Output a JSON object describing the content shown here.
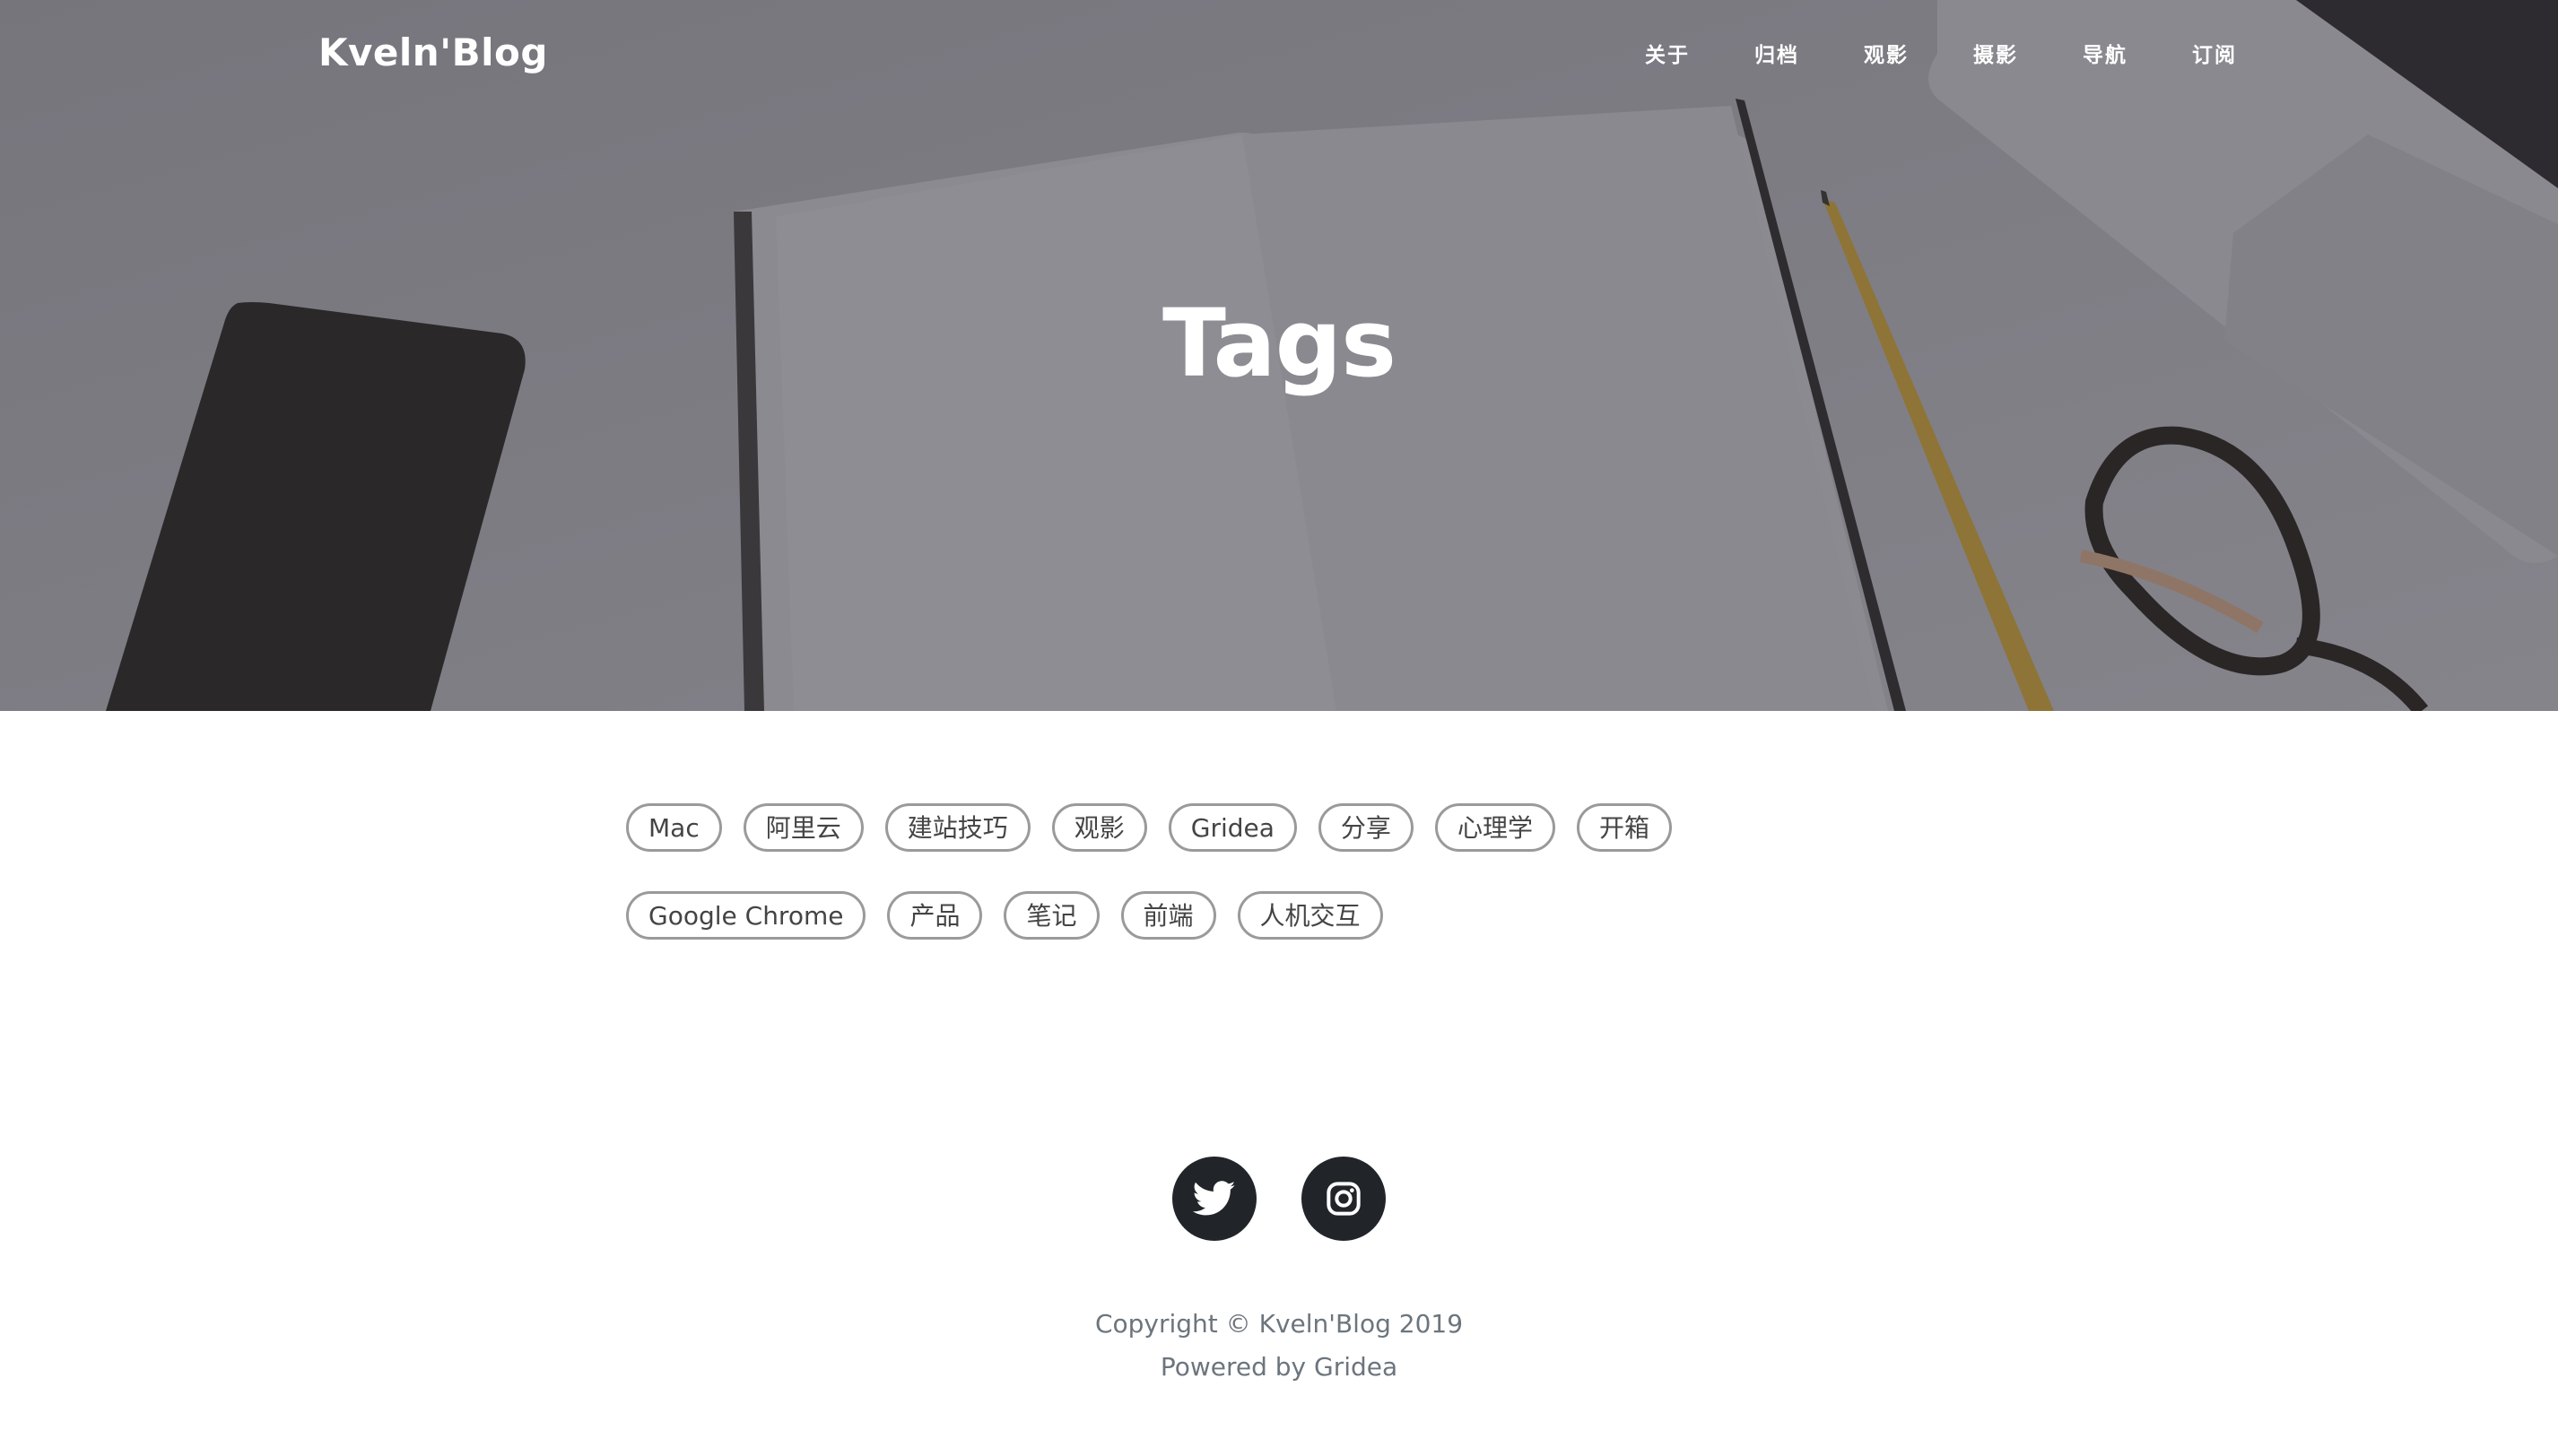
{
  "header": {
    "brand": "Kveln'Blog",
    "nav": [
      "关于",
      "归档",
      "观影",
      "摄影",
      "导航",
      "订阅"
    ]
  },
  "hero": {
    "title": "Tags",
    "overlay_color": "#7d7c83"
  },
  "tags": [
    "Mac",
    "阿里云",
    "建站技巧",
    "观影",
    "Gridea",
    "分享",
    "心理学",
    "开箱",
    "Google Chrome",
    "产品",
    "笔记",
    "前端",
    "人机交互"
  ],
  "footer": {
    "social": [
      "twitter-icon",
      "instagram-icon"
    ],
    "copyright": "Copyright © Kveln'Blog 2019",
    "powered_prefix": "Powered by ",
    "powered_link": "Gridea"
  },
  "colors": {
    "tag_border": "#9a9a9a",
    "social_bg": "#212529",
    "footer_text": "#6c757d"
  }
}
